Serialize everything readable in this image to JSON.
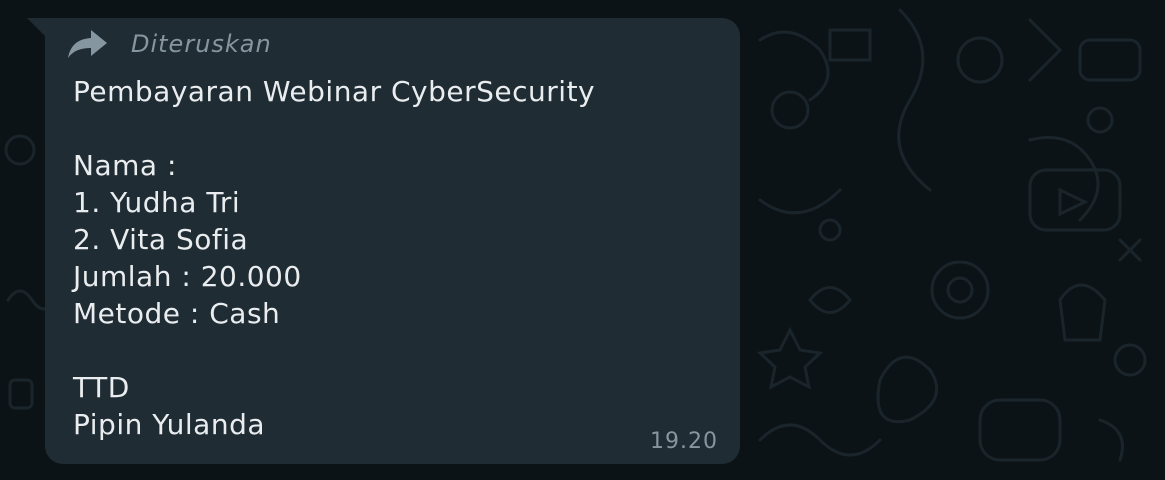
{
  "message": {
    "forwarded_label": "Diteruskan",
    "lines": [
      "Pembayaran Webinar CyberSecurity",
      "",
      "Nama :",
      "1. Yudha Tri",
      "2. Vita Sofia",
      "Jumlah : 20.000",
      "Metode : Cash",
      "",
      "TTD",
      "Pipin Yulanda"
    ],
    "time": "19.20"
  },
  "colors": {
    "background": "#0c1317",
    "bubble": "#1f2c33",
    "text": "#e9edef",
    "meta": "#8696a0"
  },
  "icons": {
    "forward": "forward-arrow-icon"
  }
}
